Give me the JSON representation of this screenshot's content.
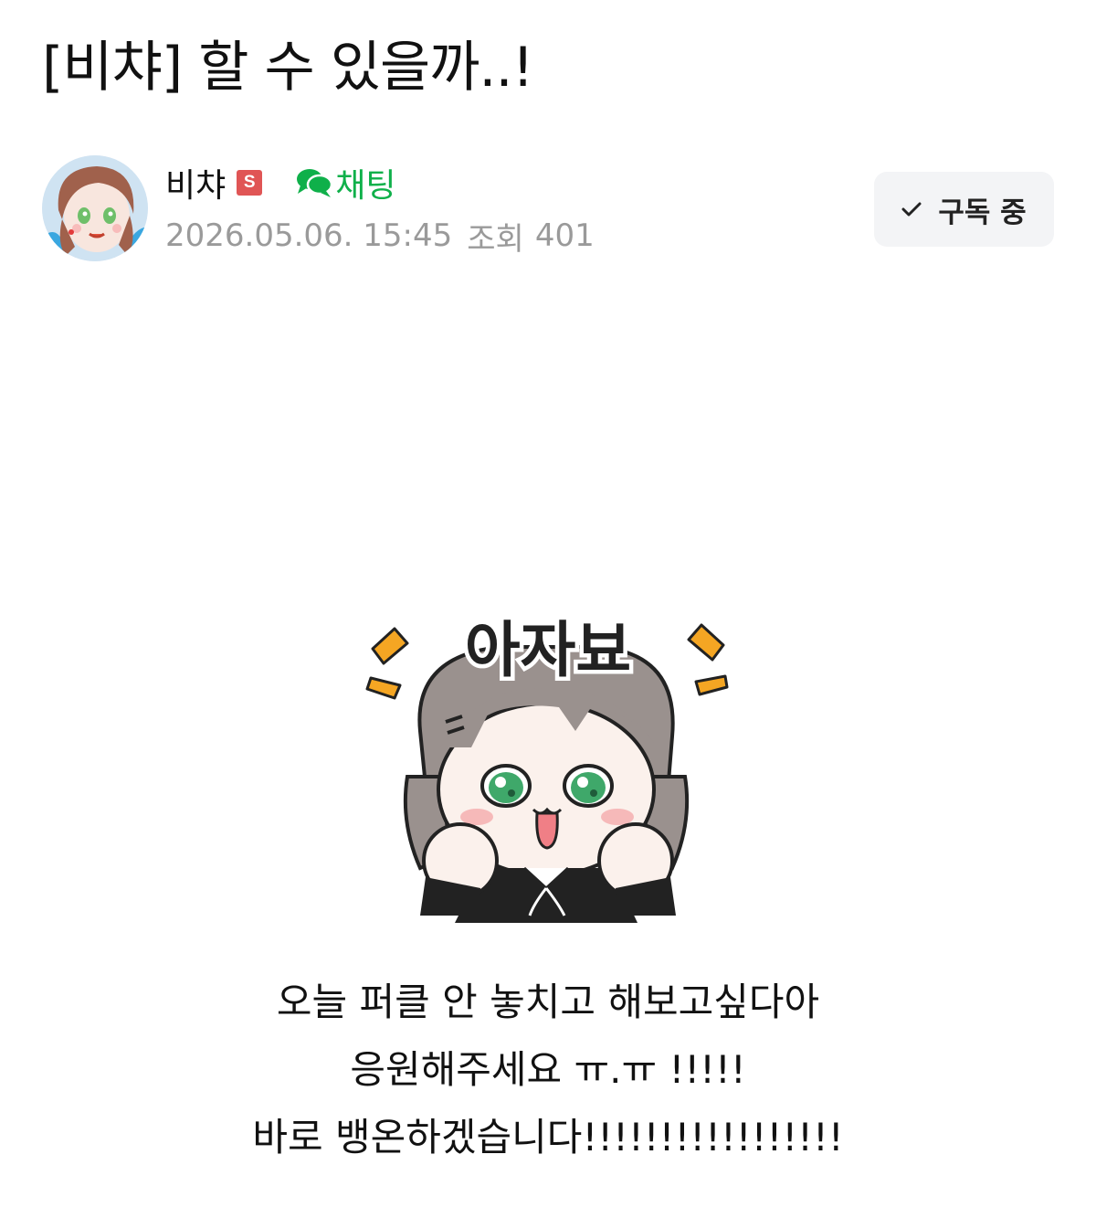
{
  "post": {
    "title": "[비챠] 할 수 있을까..!",
    "author": {
      "name": "비챠",
      "badge": "S",
      "chat_label": "채팅"
    },
    "date": "2026.05.06. 15:45",
    "views_label": "조회",
    "views_value": "401",
    "subscribe_label": "구독 중",
    "sticker": {
      "caption": "아자뵤"
    },
    "body_lines": [
      "오늘 퍼클 안 놓치고 해보고싶다아",
      "응원해주세요 ㅠ.ㅠ !!!!!",
      "바로 뱅온하겠습니다!!!!!!!!!!!!!!!!!"
    ]
  },
  "colors": {
    "chat_green": "#0fb04a",
    "badge_red": "#e05555",
    "meta_gray": "#9a9a9a",
    "subscribe_bg": "#f3f4f6",
    "sticker_accent": "#f5a623"
  },
  "icons": [
    "speech-bubbles-icon",
    "checkmark-icon"
  ]
}
